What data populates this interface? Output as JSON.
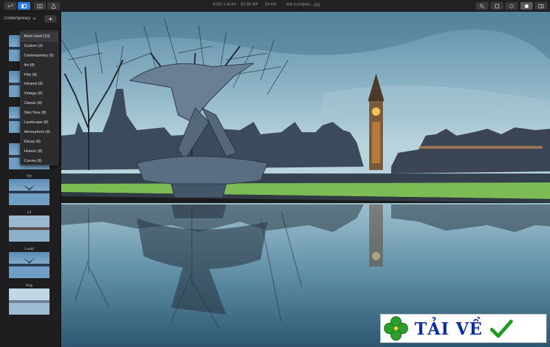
{
  "toolbar": {
    "image_info": {
      "dimensions": "6192 x 4144",
      "megapixels": "50.88 MP",
      "zoom": "39.4%",
      "filename": "wdr-lumdpiet....jpg"
    }
  },
  "sidebar": {
    "preset_category": "Contemporary",
    "presets": [
      {
        "label": ""
      },
      {
        "label": ""
      },
      {
        "label": ""
      },
      {
        "label": ""
      },
      {
        "label": "Ivy"
      },
      {
        "label": "Lil"
      },
      {
        "label": "Lucid"
      },
      {
        "label": "Fog"
      }
    ]
  },
  "menu": {
    "items": [
      "Most Used (10)",
      "Custom (3)",
      "Contemporary (6)",
      "Art (8)",
      "Film (8)",
      "Infrared (8)",
      "Vintage (8)",
      "Classic (8)",
      "Skin Tone (8)",
      "Landscape (8)",
      "Atmosphere (8)",
      "Decay (8)",
      "Historic (8)",
      "Curves (8)"
    ]
  },
  "watermark": {
    "text": "TẢI VỀ",
    "colors": {
      "text": "#0b2d9e",
      "clover": "#2e9e2a",
      "check": "#1e9e1e"
    }
  },
  "colors": {
    "accent": "#2f7de1",
    "toolbar_bg": "#222224",
    "sidebar_bg": "#1e1e20"
  }
}
